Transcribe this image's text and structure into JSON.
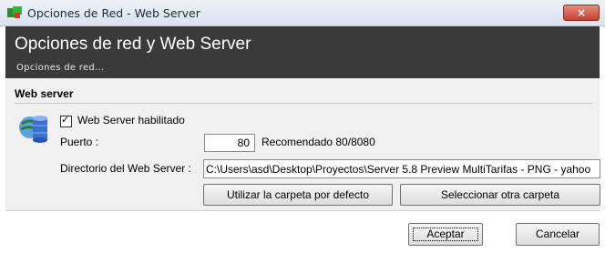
{
  "window": {
    "title": "Opciones de Red - Web Server",
    "close_glyph": "×",
    "app_icon": "green-red-window-icon"
  },
  "header": {
    "title": "Opciones de red y Web Server",
    "subtitle": "Opciones de red..."
  },
  "web_server": {
    "section_title": "Web server",
    "icon": "server-database-icon",
    "enabled_label": "Web Server habilitado",
    "enabled_checked": true,
    "check_glyph": "✓",
    "port_label": "Puerto :",
    "port_value": "80",
    "port_hint": "Recomendado 80/8080",
    "dir_label": "Directorio del Web Server :",
    "dir_value": "C:\\Users\\asd\\Desktop\\Proyectos\\Server 5.8 Preview MultiTarifas - PNG - yahoo",
    "default_folder_button": "Utilizar la carpeta por defecto",
    "other_folder_button": "Seleccionar otra carpeta"
  },
  "footer": {
    "accept_button": "Aceptar",
    "cancel_button": "Cancelar"
  },
  "colors": {
    "header_bg": "#3a3a3a",
    "panel_bg": "#f0f0f0",
    "close_button": "#c2412f"
  }
}
